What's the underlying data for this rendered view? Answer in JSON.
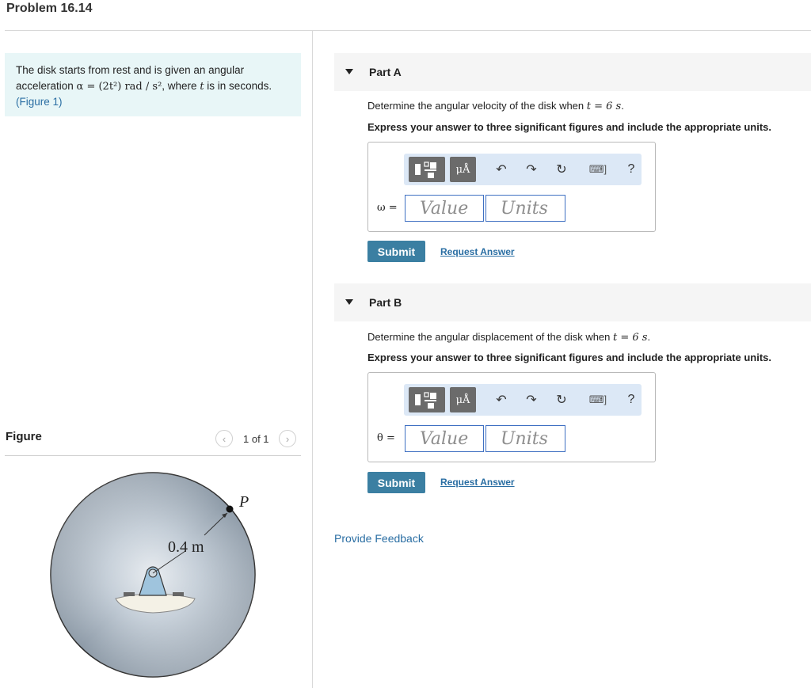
{
  "title": "Problem 16.14",
  "problem": {
    "text_a": "The disk starts from rest and is given an angular acceleration ",
    "alpha_expr": "α = (2t²) rad / s²",
    "text_b": ", where ",
    "t_var": "t",
    "text_c": " is in seconds.",
    "figure_link": "(Figure 1)"
  },
  "figure": {
    "heading": "Figure",
    "pager_text": "1 of 1",
    "radius_label": "0.4 m",
    "point_label": "P"
  },
  "parts": [
    {
      "title": "Part A",
      "question_prefix": "Determine the angular velocity of the disk when ",
      "question_math": "t = 6 s",
      "question_suffix": ".",
      "instruction": "Express your answer to three significant figures and include the appropriate units.",
      "variable_label": "ω =",
      "value_placeholder": "Value",
      "units_placeholder": "Units",
      "submit_label": "Submit",
      "request_label": "Request Answer"
    },
    {
      "title": "Part B",
      "question_prefix": "Determine the angular displacement of the disk when ",
      "question_math": "t = 6 s",
      "question_suffix": ".",
      "instruction": "Express your answer to three significant figures and include the appropriate units.",
      "variable_label": "θ =",
      "value_placeholder": "Value",
      "units_placeholder": "Units",
      "submit_label": "Submit",
      "request_label": "Request Answer"
    }
  ],
  "toolbar": {
    "units_button": "μÅ",
    "undo_icon": "undo-arrow",
    "redo_icon": "redo-arrow",
    "reset_icon": "reset-circle-arrow",
    "keyboard_icon": "keyboard",
    "help_label": "?"
  },
  "feedback_label": "Provide Feedback"
}
